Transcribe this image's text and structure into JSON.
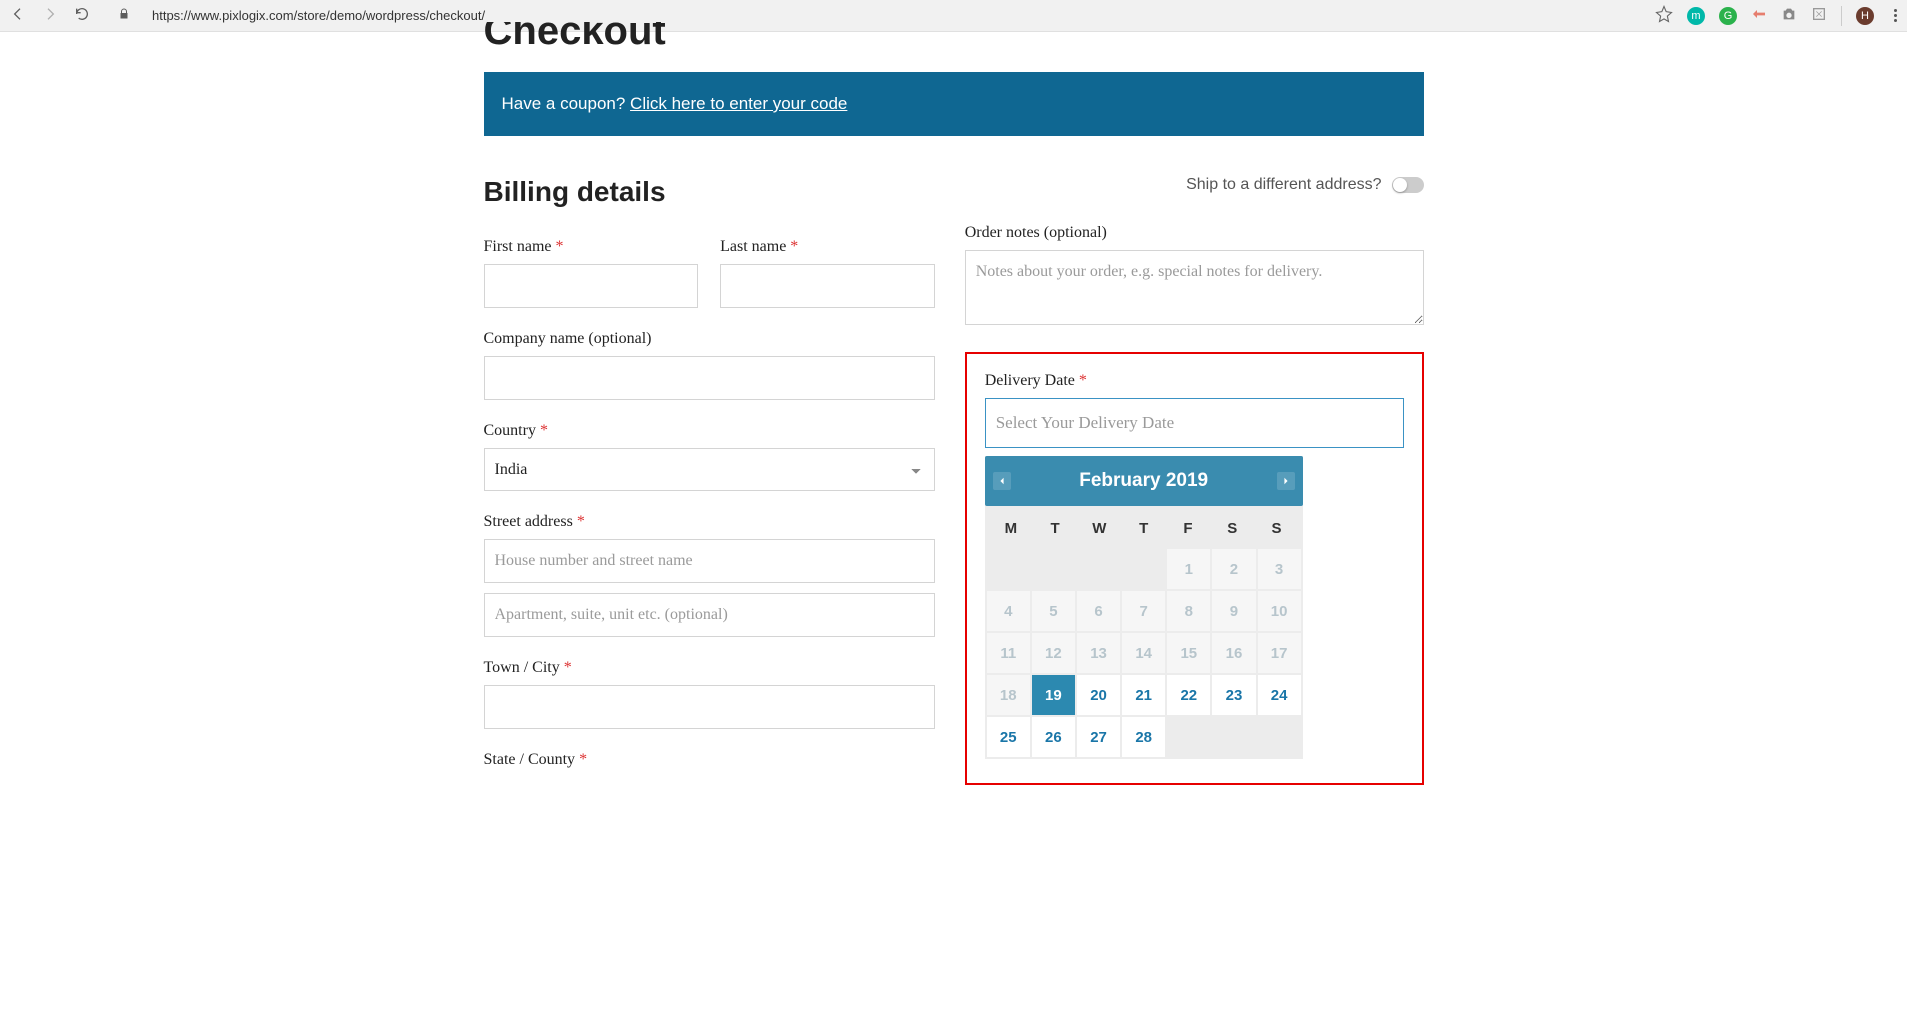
{
  "browser": {
    "url": "https://www.pixlogix.com/store/demo/wordpress/checkout/"
  },
  "page": {
    "title": "Checkout",
    "coupon_prompt": "Have a coupon? ",
    "coupon_link": "Click here to enter your code"
  },
  "billing": {
    "heading": "Billing details",
    "first_name_label": "First name ",
    "last_name_label": "Last name ",
    "company_label": "Company name (optional)",
    "country_label": "Country ",
    "country_value": "India",
    "street_label": "Street address ",
    "street_placeholder": "House number and street name",
    "street2_placeholder": "Apartment, suite, unit etc. (optional)",
    "town_label": "Town / City ",
    "state_label": "State / County "
  },
  "shipping": {
    "ship_diff_label": "Ship to a different address?",
    "order_notes_label": "Order notes (optional)",
    "order_notes_placeholder": "Notes about your order, e.g. special notes for delivery."
  },
  "delivery": {
    "label": "Delivery Date ",
    "placeholder": "Select Your Delivery Date",
    "calendar": {
      "month_title": "February 2019",
      "dow": [
        "M",
        "T",
        "W",
        "T",
        "F",
        "S",
        "S"
      ],
      "leading_blanks": 4,
      "days": [
        {
          "n": 1,
          "state": "past"
        },
        {
          "n": 2,
          "state": "past"
        },
        {
          "n": 3,
          "state": "past"
        },
        {
          "n": 4,
          "state": "past"
        },
        {
          "n": 5,
          "state": "past"
        },
        {
          "n": 6,
          "state": "past"
        },
        {
          "n": 7,
          "state": "past"
        },
        {
          "n": 8,
          "state": "past"
        },
        {
          "n": 9,
          "state": "past"
        },
        {
          "n": 10,
          "state": "past"
        },
        {
          "n": 11,
          "state": "past"
        },
        {
          "n": 12,
          "state": "past"
        },
        {
          "n": 13,
          "state": "past"
        },
        {
          "n": 14,
          "state": "past"
        },
        {
          "n": 15,
          "state": "past"
        },
        {
          "n": 16,
          "state": "past"
        },
        {
          "n": 17,
          "state": "past"
        },
        {
          "n": 18,
          "state": "past"
        },
        {
          "n": 19,
          "state": "today"
        },
        {
          "n": 20,
          "state": "avail"
        },
        {
          "n": 21,
          "state": "avail"
        },
        {
          "n": 22,
          "state": "avail"
        },
        {
          "n": 23,
          "state": "avail"
        },
        {
          "n": 24,
          "state": "avail"
        },
        {
          "n": 25,
          "state": "avail"
        },
        {
          "n": 26,
          "state": "avail"
        },
        {
          "n": 27,
          "state": "avail"
        },
        {
          "n": 28,
          "state": "avail"
        }
      ]
    }
  }
}
